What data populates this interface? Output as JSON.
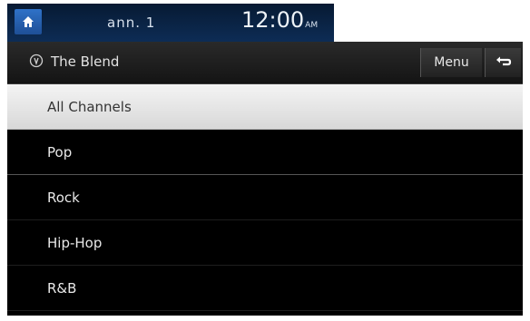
{
  "status_bar": {
    "source_label": "ann. 1",
    "time": "12:00",
    "ampm": "AM"
  },
  "title_bar": {
    "title": "The Blend",
    "menu_label": "Menu"
  },
  "channels": [
    {
      "label": "All Channels",
      "selected": true
    },
    {
      "label": "Pop",
      "selected": false
    },
    {
      "label": "Rock",
      "selected": false
    },
    {
      "label": "Hip-Hop",
      "selected": false
    },
    {
      "label": "R&B",
      "selected": false
    }
  ],
  "colors": {
    "status_bg": "#0d2c55",
    "home_button": "#2f72c8",
    "selected_row": "#e8e8e8"
  },
  "icons": {
    "home": "home-icon",
    "title": "radio-icon",
    "back": "back-arrow-icon"
  }
}
